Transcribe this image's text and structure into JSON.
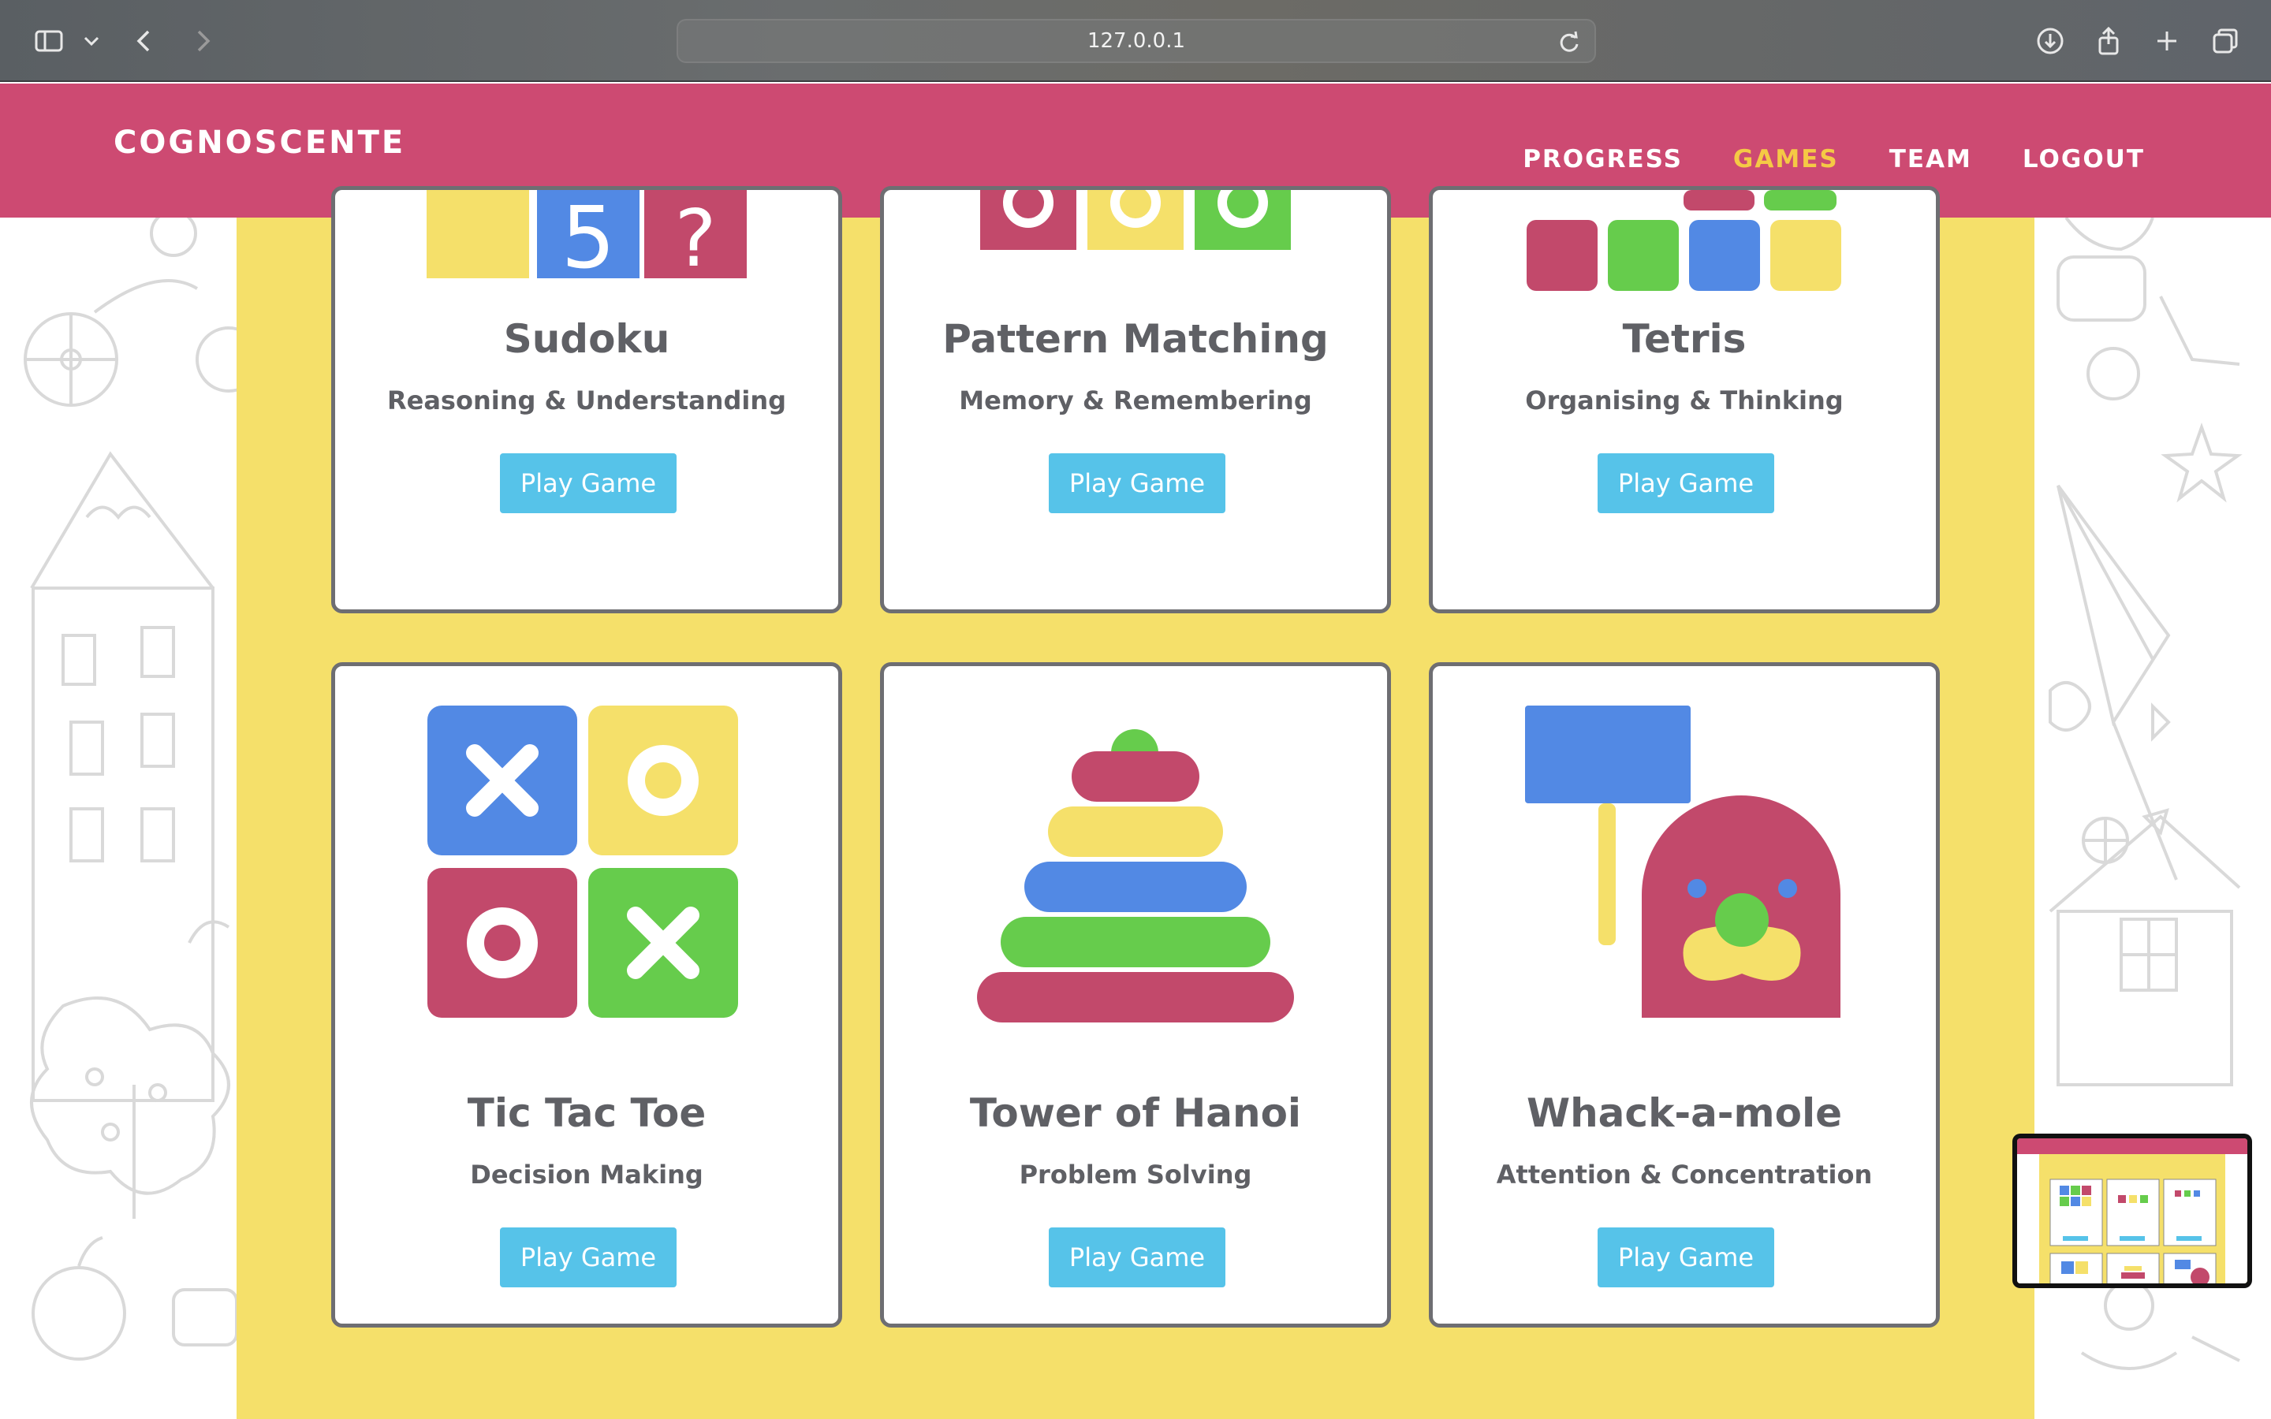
{
  "browser": {
    "url": "127.0.0.1"
  },
  "header": {
    "brand": "COGNOSCENTE",
    "nav": [
      {
        "label": "PROGRESS",
        "active": false
      },
      {
        "label": "GAMES",
        "active": true
      },
      {
        "label": "TEAM",
        "active": false
      },
      {
        "label": "LOGOUT",
        "active": false
      }
    ]
  },
  "colors": {
    "header_bg": "#cd4a72",
    "nav_active": "#f5c945",
    "panel_bg": "#f5e06a",
    "button_bg": "#56c3e9",
    "tile_blue": "#5289e4",
    "tile_yellow": "#f5e06a",
    "tile_red": "#c2496b",
    "tile_green": "#66cc4c"
  },
  "games": [
    {
      "title": "Sudoku",
      "subtitle": "Reasoning & Understanding",
      "button": "Play Game"
    },
    {
      "title": "Pattern Matching",
      "subtitle": "Memory & Remembering",
      "button": "Play Game"
    },
    {
      "title": "Tetris",
      "subtitle": "Organising & Thinking",
      "button": "Play Game"
    },
    {
      "title": "Tic Tac Toe",
      "subtitle": "Decision Making",
      "button": "Play Game"
    },
    {
      "title": "Tower of Hanoi",
      "subtitle": "Problem Solving",
      "button": "Play Game"
    },
    {
      "title": "Whack-a-mole",
      "subtitle": "Attention & Concentration",
      "button": "Play Game"
    }
  ],
  "sudoku_tiles": [
    "5",
    "?"
  ],
  "icons": [
    "sidebar-icon",
    "chevron-down-icon",
    "back-icon",
    "forward-icon",
    "reload-icon",
    "download-icon",
    "share-icon",
    "new-tab-icon",
    "tabs-overview-icon"
  ]
}
